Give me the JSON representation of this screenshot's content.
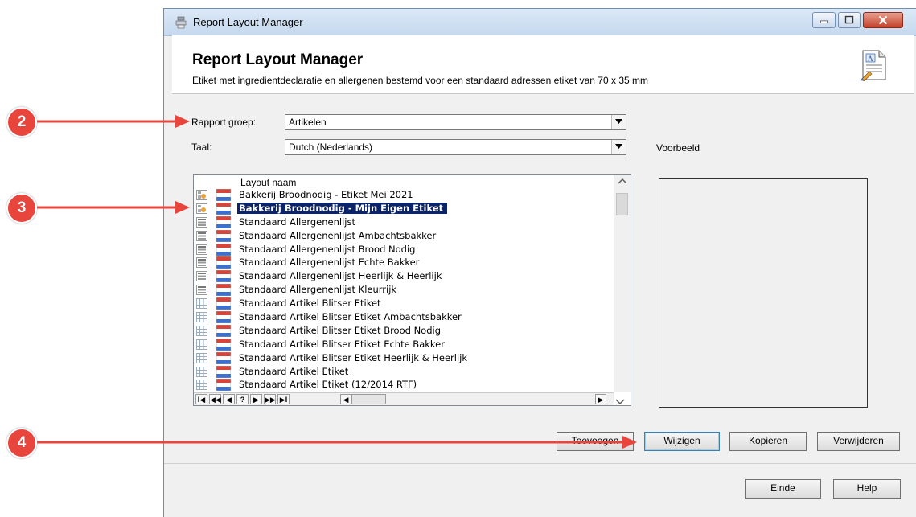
{
  "window": {
    "title": "Report Layout Manager",
    "header_title": "Report Layout Manager",
    "header_subtitle": "Etiket met ingredientdeclaratie en allergenen bestemd voor een standaard adressen etiket van 70 x 35 mm"
  },
  "form": {
    "group_label": "Rapport groep:",
    "group_value": "Artikelen",
    "language_label": "Taal:",
    "language_value": "Dutch (Nederlands)",
    "preview_label": "Voorbeeld"
  },
  "list": {
    "column_header": "Layout naam",
    "selected_index": 1,
    "items": [
      "Bakkerij Broodnodig - Etiket Mei 2021",
      "Bakkerij Broodnodig - Mijn Eigen Etiket",
      "Standaard Allergenenlijst",
      "Standaard Allergenenlijst Ambachtsbakker",
      "Standaard Allergenenlijst Brood Nodig",
      "Standaard Allergenenlijst Echte Bakker",
      "Standaard Allergenenlijst Heerlijk & Heerlijk",
      "Standaard Allergenenlijst Kleurrijk",
      "Standaard Artikel Blitser Etiket",
      "Standaard Artikel Blitser Etiket Ambachtsbakker",
      "Standaard Artikel Blitser Etiket Brood Nodig",
      "Standaard Artikel Blitser Etiket Echte Bakker",
      "Standaard Artikel Blitser Etiket Heerlijk & Heerlijk",
      "Standaard Artikel Etiket",
      "Standaard Artikel Etiket (12/2014 RTF)"
    ],
    "nav_buttons": [
      "I◀",
      "◀◀",
      "◀",
      "?",
      "▶",
      "▶▶",
      "▶I"
    ]
  },
  "buttons": {
    "add": "Toevoegen",
    "edit": "Wijzigen",
    "copy": "Kopieren",
    "delete": "Verwijderen",
    "close": "Einde",
    "help": "Help"
  },
  "annotations": [
    "2",
    "3",
    "4"
  ],
  "colors": {
    "annotation_red": "#e8453c",
    "selection_blue": "#0a246a"
  }
}
